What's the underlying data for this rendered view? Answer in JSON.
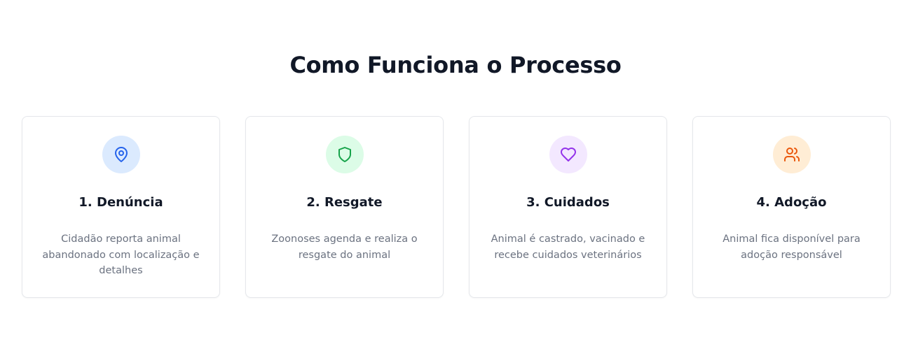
{
  "section": {
    "title": "Como Funciona o Processo"
  },
  "steps": [
    {
      "title": "1. Denúncia",
      "description": "Cidadão reporta animal abandonado com localização e detalhes",
      "icon": "map-pin-icon",
      "icon_color": "#2563eb",
      "icon_bg": "#dbeafe"
    },
    {
      "title": "2. Resgate",
      "description": "Zoonoses agenda e realiza o resgate do animal",
      "icon": "shield-icon",
      "icon_color": "#16a34a",
      "icon_bg": "#dcfce7"
    },
    {
      "title": "3. Cuidados",
      "description": "Animal é castrado, vacinado e recebe cuidados veterinários",
      "icon": "heart-icon",
      "icon_color": "#9333ea",
      "icon_bg": "#f3e8ff"
    },
    {
      "title": "4. Adoção",
      "description": "Animal fica disponível para adoção responsável",
      "icon": "users-icon",
      "icon_color": "#ea580c",
      "icon_bg": "#ffedd5"
    }
  ]
}
